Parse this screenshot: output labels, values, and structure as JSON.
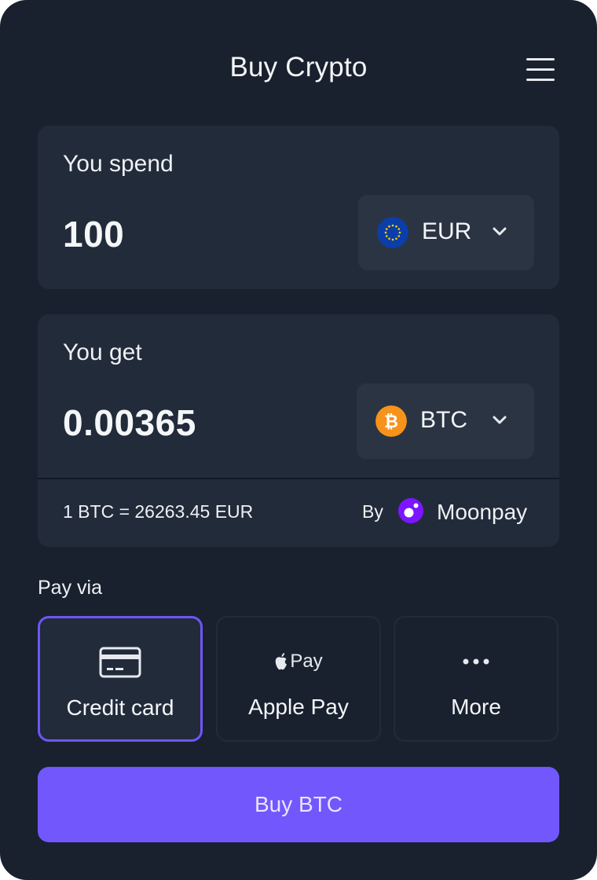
{
  "header": {
    "title": "Buy Crypto",
    "menu_icon": "hamburger-menu-icon"
  },
  "spend": {
    "label": "You spend",
    "amount": "100",
    "currency": "EUR",
    "currency_icon": "eu-flag-icon"
  },
  "get": {
    "label": "You get",
    "amount": "0.00365",
    "currency": "BTC",
    "currency_icon": "bitcoin-icon"
  },
  "rate": {
    "text": "1 BTC = 26263.45 EUR",
    "by_label": "By",
    "provider": "Moonpay",
    "provider_icon": "moonpay-logo-icon"
  },
  "payment": {
    "label": "Pay via",
    "selected": "Credit card",
    "options": [
      {
        "label": "Credit card",
        "icon": "credit-card-icon"
      },
      {
        "label": "Apple Pay",
        "icon": "apple-pay-logo-icon",
        "icon_text": "Pay"
      },
      {
        "label": "More",
        "icon": "more-dots-icon"
      }
    ]
  },
  "buy_button": {
    "label": "Buy BTC"
  },
  "colors": {
    "background": "#19212e",
    "card": "#222b3a",
    "selector": "#2b3443",
    "accent": "#7157fc",
    "selected_border": "#6e56f6",
    "bitcoin": "#f7931a",
    "eu_blue": "#0b3ea8",
    "eu_star": "#ffd400",
    "moonpay": "#7b16ff"
  }
}
